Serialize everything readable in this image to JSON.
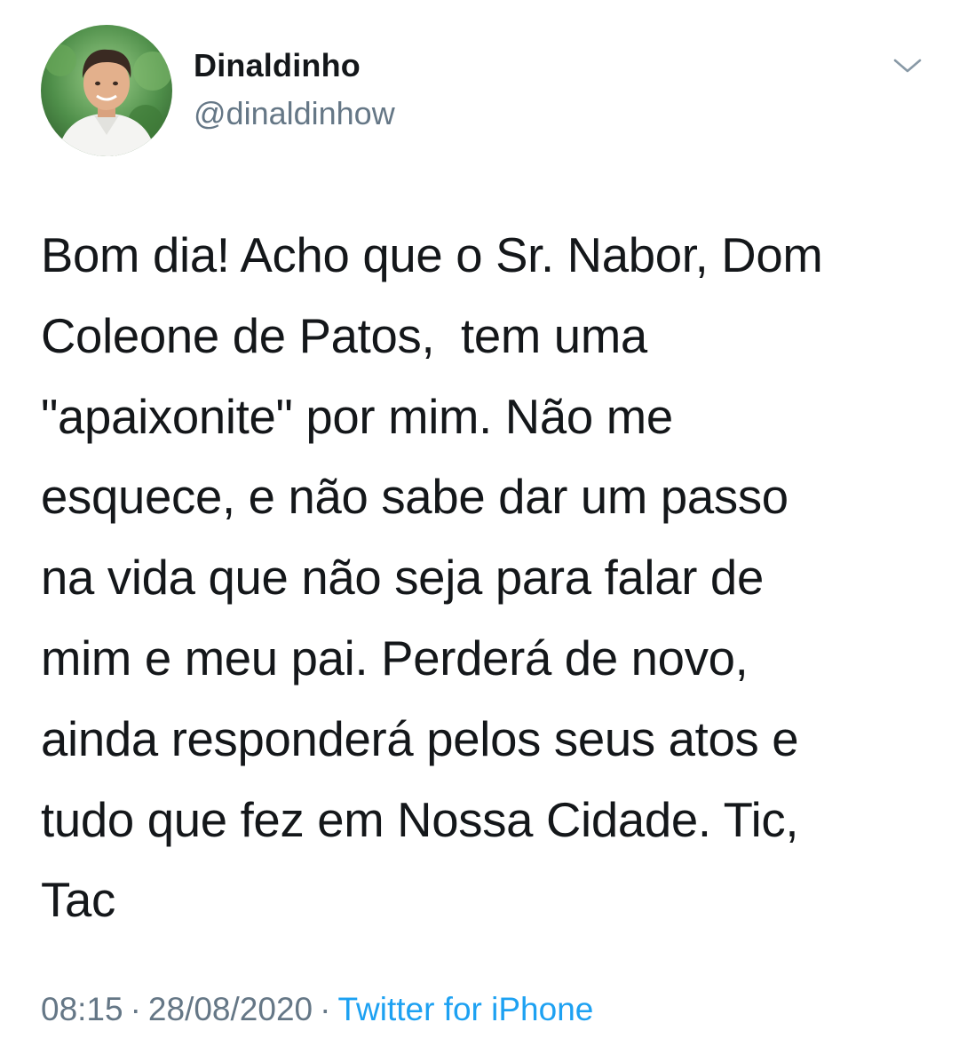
{
  "author": {
    "display_name": "Dinaldinho",
    "handle": "@dinaldinhow",
    "avatar_icon": "user-photo-avatar"
  },
  "tweet": {
    "text": "Bom dia! Acho que o Sr. Nabor, Dom\nColeone de Patos,  tem uma\n\"apaixonite\" por mim. Não me\nesquece, e não sabe dar um passo\nna vida que não seja para falar de\nmim e meu pai. Perderá de novo,\nainda responderá pelos seus atos e\ntudo que fez em Nossa Cidade. Tic,\nTac"
  },
  "meta": {
    "time": "08:15",
    "separator": "·",
    "date": "28/08/2020",
    "source": "Twitter for iPhone"
  },
  "icons": {
    "menu": "chevron-down-icon"
  },
  "colors": {
    "text_primary": "#14171a",
    "text_secondary": "#657786",
    "link": "#1da1f2",
    "background": "#ffffff"
  }
}
